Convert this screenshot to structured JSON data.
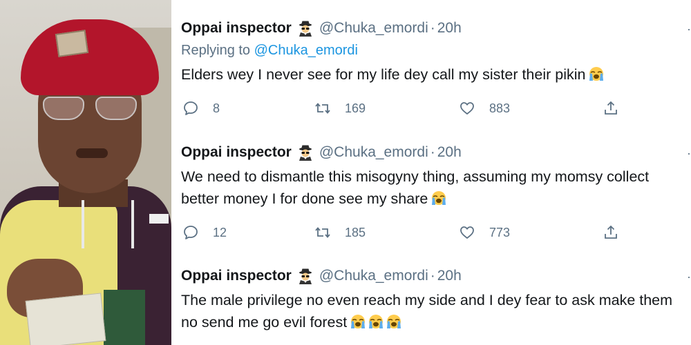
{
  "colors": {
    "name": "#14171a",
    "meta": "#5b7083",
    "mention": "#1b95e0",
    "background": "#ffffff"
  },
  "photo": {
    "description_icon": "person-photo"
  },
  "tweets": [
    {
      "author_name": "Oppai inspector",
      "author_emoji": "sleuth-spy-icon",
      "handle": "@Chuka_emordi",
      "separator": "·",
      "time": "20h",
      "replying_to_label": "Replying to",
      "replying_to_handle": "@Chuka_emordi",
      "text": "Elders wey I never see for my life dey call my sister their pikin",
      "emoji": "loudly-crying-face-icon",
      "replies": "8",
      "retweets": "169",
      "likes": "883"
    },
    {
      "author_name": "Oppai inspector",
      "author_emoji": "sleuth-spy-icon",
      "handle": "@Chuka_emordi",
      "separator": "·",
      "time": "20h",
      "text_line1": "We need to dismantle this misogyny thing, assuming my momsy collect",
      "text_line2": "better money I for done see my share",
      "emoji": "loudly-crying-face-icon",
      "replies": "12",
      "retweets": "185",
      "likes": "773"
    },
    {
      "author_name": "Oppai inspector",
      "author_emoji": "sleuth-spy-icon",
      "handle": "@Chuka_emordi",
      "separator": "·",
      "time": "20h",
      "text_line1": "The male privilege no even reach my side and I dey fear to ask make them",
      "text_line2": "no send me go evil forest",
      "emoji": "loudly-crying-face-icon"
    }
  ]
}
